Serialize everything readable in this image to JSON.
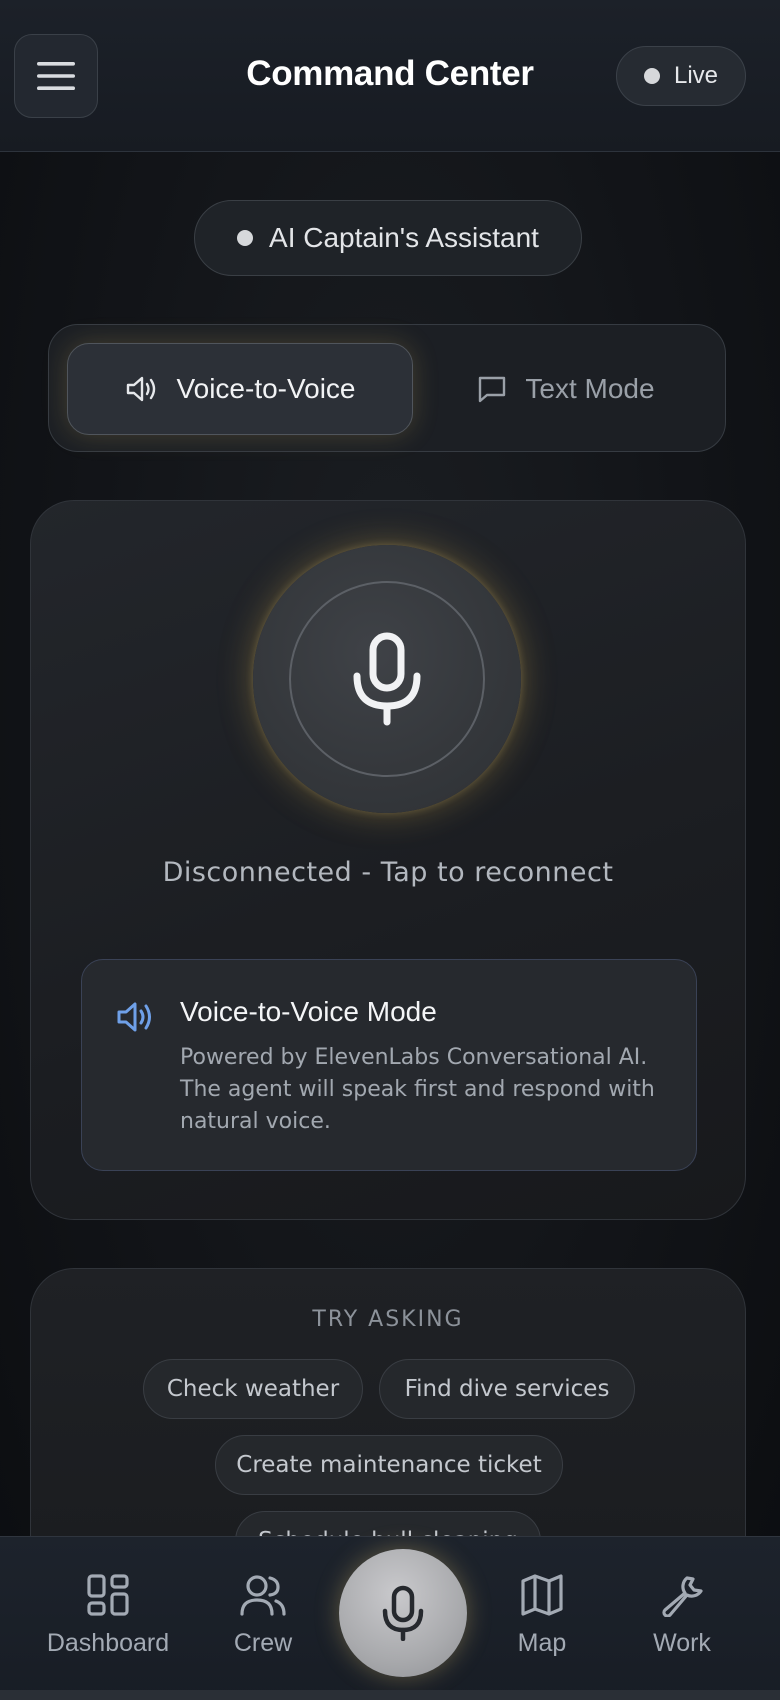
{
  "header": {
    "title": "Command Center",
    "status_label": "Live"
  },
  "assistant": {
    "label": "AI Captain's Assistant"
  },
  "mode_toggle": {
    "voice_label": "Voice-to-Voice",
    "text_label": "Text Mode",
    "selected": "Voice-to-Voice"
  },
  "voice_panel": {
    "status": "Disconnected - Tap to reconnect",
    "info_title": "Voice-to-Voice Mode",
    "info_body": "Powered by ElevenLabs Conversational AI. The agent will speak first and respond with natural voice."
  },
  "try_asking": {
    "title": "TRY ASKING",
    "chips": [
      "Check weather",
      "Find dive services",
      "Create maintenance ticket",
      "Schedule hull cleaning"
    ]
  },
  "bottom_nav": {
    "items": [
      {
        "label": "Dashboard",
        "icon": "grid-icon"
      },
      {
        "label": "Crew",
        "icon": "users-icon"
      },
      {
        "label": "Map",
        "icon": "map-icon"
      },
      {
        "label": "Work",
        "icon": "wrench-icon"
      }
    ],
    "center_icon": "microphone-icon"
  },
  "colors": {
    "accent_glow": "#d8b45a",
    "info_icon": "#6fa0e8",
    "background": "#121418"
  }
}
